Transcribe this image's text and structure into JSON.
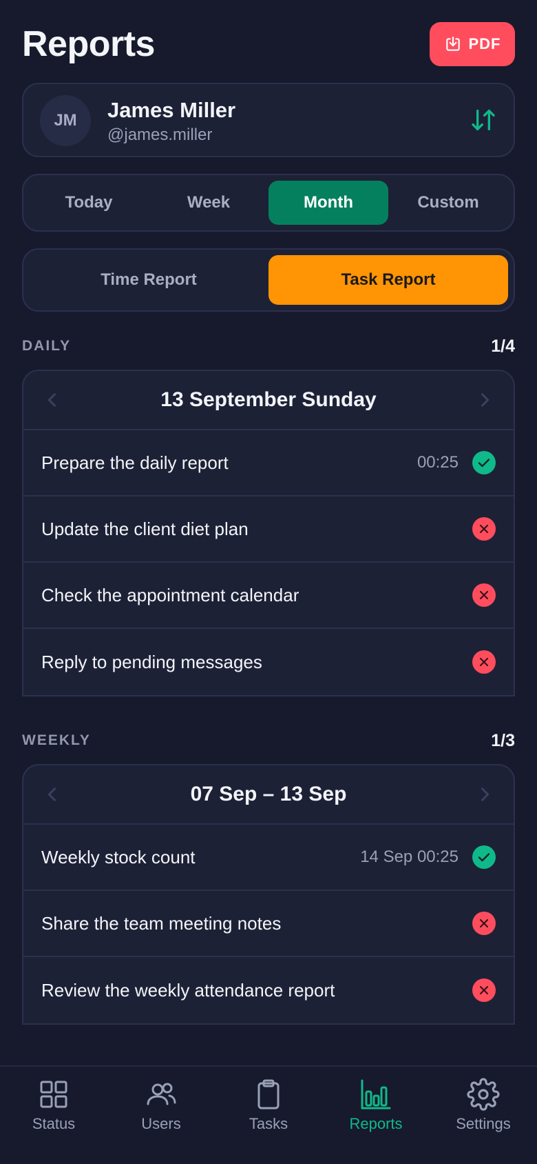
{
  "header": {
    "title": "Reports",
    "pdf_label": "PDF"
  },
  "profile": {
    "initials": "JM",
    "name": "James Miller",
    "handle": "@james.miller"
  },
  "period_tabs": {
    "items": [
      "Today",
      "Week",
      "Month",
      "Custom"
    ],
    "selected": "Month"
  },
  "report_tabs": {
    "items": [
      "Time Report",
      "Task Report"
    ],
    "selected": "Task Report"
  },
  "daily": {
    "label": "DAILY",
    "count": "1/4",
    "date": "13 September Sunday",
    "tasks": [
      {
        "title": "Prepare the daily report",
        "time": "00:25",
        "status": "done"
      },
      {
        "title": "Update the client diet plan",
        "time": "",
        "status": "missed"
      },
      {
        "title": "Check the appointment calendar",
        "time": "",
        "status": "missed"
      },
      {
        "title": "Reply to pending messages",
        "time": "",
        "status": "missed"
      }
    ]
  },
  "weekly": {
    "label": "WEEKLY",
    "count": "1/3",
    "date": "07 Sep – 13 Sep",
    "tasks": [
      {
        "title": "Weekly stock count",
        "time": "14 Sep 00:25",
        "status": "done"
      },
      {
        "title": "Share the team meeting notes",
        "time": "",
        "status": "missed"
      },
      {
        "title": "Review the weekly attendance report",
        "time": "",
        "status": "missed"
      }
    ]
  },
  "nav": {
    "items": [
      {
        "label": "Status",
        "icon": "grid-icon"
      },
      {
        "label": "Users",
        "icon": "users-icon"
      },
      {
        "label": "Tasks",
        "icon": "clipboard-icon"
      },
      {
        "label": "Reports",
        "icon": "bar-chart-icon"
      },
      {
        "label": "Settings",
        "icon": "gear-icon"
      }
    ],
    "active": "Reports"
  },
  "colors": {
    "background": "#161a2c",
    "card": "#1d2136",
    "accent_green": "#05805f",
    "accent_orange": "#ff9404",
    "danger": "#ff4d5e",
    "success": "#10b98a"
  }
}
